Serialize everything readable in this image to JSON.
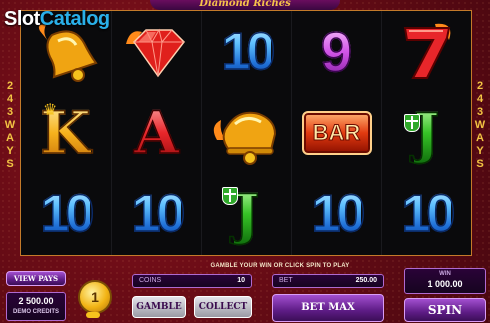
{
  "watermark": {
    "slot": "Slot",
    "catalog": "Catalog"
  },
  "title_banner": "Diamond Riches",
  "ways": {
    "left": [
      "2",
      "4",
      "3",
      "W",
      "A",
      "Y",
      "S"
    ],
    "right": [
      "2",
      "4",
      "3",
      "W",
      "A",
      "Y",
      "S"
    ]
  },
  "reels": [
    [
      "bell",
      "K",
      "10"
    ],
    [
      "diamond",
      "A",
      "10"
    ],
    [
      "10",
      "bell",
      "J"
    ],
    [
      "9",
      "BAR",
      "10"
    ],
    [
      "7",
      "J",
      "10"
    ]
  ],
  "symbols": {
    "bar_label": "BAR",
    "seven": "7",
    "nine": "9",
    "ten": "10",
    "king": "K",
    "ace": "A",
    "jack": "J"
  },
  "message": "GAMBLE YOUR WIN OR CLICK SPIN TO PLAY",
  "left_panel": {
    "view_pays": "VIEW PAYS",
    "credits_value": "2 500.00",
    "credits_label": "DEMO CREDITS"
  },
  "coin": {
    "value": "1"
  },
  "coins": {
    "label": "COINS",
    "value": "10"
  },
  "bet": {
    "label": "BET",
    "value": "250.00"
  },
  "win": {
    "label": "WIN",
    "value": "1 000.00"
  },
  "buttons": {
    "gamble": "GAMBLE",
    "collect": "COLLECT",
    "bet_max": "BET MAX",
    "spin": "SPIN"
  },
  "colors": {
    "background": "#6b0c16",
    "reel_bg": "#0a0a0c",
    "accent_purple": "#5e1c86",
    "gold": "#f2c443"
  }
}
